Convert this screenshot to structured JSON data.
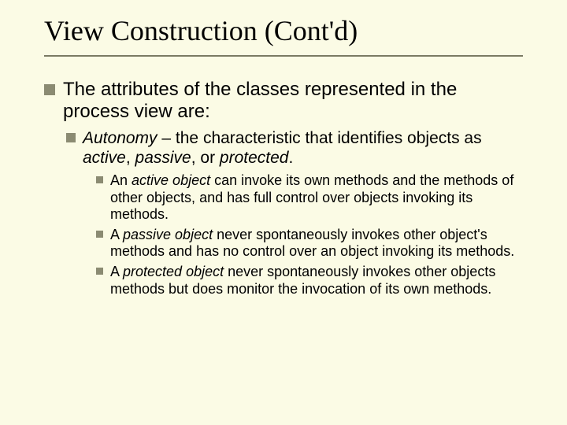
{
  "title": "View Construction (Cont'd)",
  "l1": {
    "pre": "The attributes of the classes represented in the process view are:"
  },
  "l2": {
    "term": "Autonomy",
    "dash": " – the characteristic that identifies objects as ",
    "k1": "active",
    "c1": ", ",
    "k2": "passive",
    "c2": ", or ",
    "k3": "protected",
    "end": "."
  },
  "l3a": {
    "pre": "An ",
    "term": "active object",
    "post": " can invoke its own methods and the methods of other objects, and has full control over objects invoking its methods."
  },
  "l3b": {
    "pre": "A ",
    "term": "passive object",
    "post": " never spontaneously invokes other object's methods and has no control over an object invoking its methods."
  },
  "l3c": {
    "pre": "A ",
    "term": "protected object",
    "post": " never spontaneously invokes other objects methods but does monitor the invocation of its own methods."
  }
}
